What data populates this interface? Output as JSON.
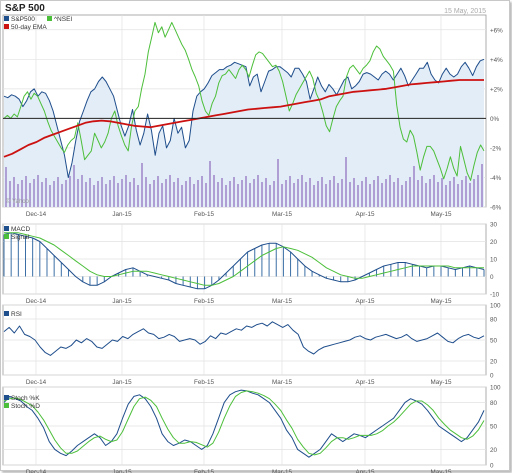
{
  "title": "S&P 500",
  "date": "15 May, 2015",
  "watermark": "© Yahoo!",
  "legend": {
    "sp500": "S&P500",
    "nsei": "^NSEI",
    "ema": "50-day EMA",
    "macd": "MACD",
    "signal": "Signal",
    "rsi": "RSI",
    "stochk": "Stoch %K",
    "stochd": "Stoch %D"
  },
  "colors": {
    "sp500": "#1f4e8c",
    "nsei": "#4cbf3a",
    "ema": "#cc1111",
    "volume": "#8a6bbd",
    "grid": "#e2e2e2",
    "fill": "#e3edf7"
  },
  "chart_data": [
    {
      "type": "line",
      "name": "price",
      "x_tick_labels": [
        "Dec-14",
        "Jan-15",
        "Feb-15",
        "Mar-15",
        "Apr-15",
        "May-15"
      ],
      "y_tick_labels": [
        "+6%",
        "+4%",
        "+2%",
        "0%",
        "-2%",
        "-4%",
        "-6%"
      ],
      "ylim": [
        -6,
        7
      ],
      "series": [
        {
          "name": "S&P500",
          "values": [
            1.5,
            1.4,
            1.6,
            1.5,
            1.3,
            0.8,
            1.2,
            1.8,
            2.0,
            1.5,
            1.8,
            1.7,
            1.2,
            0.5,
            -0.5,
            -1.5,
            -2.5,
            -4.0,
            -3.0,
            -1.5,
            -0.2,
            0.5,
            1.2,
            1.8,
            2.0,
            2.5,
            2.8,
            2.5,
            2.0,
            1.5,
            0.5,
            -0.5,
            -1.2,
            -0.5,
            0.6,
            -0.8,
            -1.8,
            -1.0,
            0.3,
            -0.8,
            -2.5,
            -1.0,
            -0.5,
            -2.0,
            -1.5,
            0.0,
            -1.0,
            -0.6,
            -2.0,
            -1.5,
            0.5,
            1.5,
            1.8,
            2.0,
            2.4,
            2.9,
            3.1,
            3.3,
            3.3,
            3.5,
            3.6,
            3.8,
            3.7,
            3.6,
            3.5,
            2.2,
            2.8,
            3.0,
            1.8,
            2.5,
            3.2,
            3.3,
            3.5,
            3.5,
            3.3,
            3.1,
            2.8,
            3.4,
            3.4,
            3.0,
            2.5,
            1.3,
            2.0,
            2.8,
            2.2,
            1.8,
            2.3,
            2.0,
            1.6,
            2.1,
            2.6,
            2.8,
            2.0,
            2.2,
            2.5,
            3.0,
            3.1,
            3.0,
            2.8,
            2.6,
            3.0,
            3.2,
            3.0,
            2.6,
            3.0,
            3.4,
            2.9,
            2.2,
            2.6,
            3.0,
            3.4,
            3.4,
            3.8,
            3.0,
            2.6,
            2.4,
            3.0,
            3.4,
            3.0,
            2.8,
            3.0,
            3.5,
            3.8,
            3.4,
            2.9,
            3.5,
            3.9,
            4.0
          ]
        },
        {
          "name": "^NSEI",
          "values": [
            0.0,
            0.2,
            0.0,
            0.3,
            0.1,
            0.8,
            1.5,
            1.8,
            1.3,
            1.7,
            1.5,
            1.0,
            0.5,
            -0.2,
            -0.8,
            -1.2,
            -1.6,
            -2.0,
            -2.3,
            -1.8,
            -1.5,
            -1.3,
            -0.3,
            -1.5,
            -2.8,
            -2.5,
            -2.2,
            -1.0,
            -1.5,
            -2.0,
            -1.6,
            -1.0,
            0.0,
            0.5,
            -0.5,
            -1.2,
            -1.8,
            -2.2,
            -0.5,
            0.5,
            0.8,
            2.0,
            3.0,
            4.5,
            5.5,
            6.5,
            5.8,
            6.2,
            5.5,
            6.0,
            6.5,
            6.0,
            5.5,
            5.0,
            4.6,
            4.0,
            3.3,
            2.8,
            2.2,
            1.2,
            0.5,
            0.2,
            1.0,
            1.5,
            2.4,
            2.9,
            3.0,
            3.3,
            3.0,
            2.7,
            3.3,
            3.6,
            3.3,
            2.8,
            3.6,
            4.3,
            4.5,
            4.4,
            4.1,
            3.8,
            3.5,
            3.6,
            3.2,
            2.5,
            1.5,
            0.5,
            1.0,
            1.6,
            2.0,
            2.4,
            2.8,
            3.2,
            2.7,
            1.7,
            1.2,
            0.4,
            -0.5,
            -0.9,
            0.0,
            0.8,
            1.2,
            1.5,
            2.8,
            3.4,
            3.6,
            3.3,
            3.0,
            3.4,
            3.6,
            3.9,
            4.5,
            4.9,
            4.7,
            4.2,
            3.9,
            3.6,
            3.2,
            0.9,
            -0.6,
            -1.4,
            -1.6,
            -0.8,
            -1.2,
            -2.3,
            -3.5,
            -2.6,
            -1.9,
            -1.9,
            -2.2,
            -2.8,
            -3.4,
            -4.1,
            -3.4,
            -2.6,
            -3.4,
            -3.9,
            -1.9,
            -2.8,
            -3.7,
            -4.2,
            -3.2,
            -2.3,
            -1.8,
            -2.2
          ]
        },
        {
          "name": "50-day EMA",
          "values": [
            -2.6,
            -2.4,
            -2.1,
            -1.8,
            -1.6,
            -1.3,
            -1.1,
            -0.9,
            -0.7,
            -0.5,
            -0.3,
            -0.2,
            -0.15,
            -0.2,
            -0.3,
            -0.4,
            -0.5,
            -0.55,
            -0.6,
            -0.5,
            -0.4,
            -0.3,
            -0.2,
            -0.1,
            0.0,
            0.1,
            0.2,
            0.3,
            0.4,
            0.5,
            0.6,
            0.65,
            0.7,
            0.75,
            0.8,
            0.9,
            1.0,
            1.1,
            1.2,
            1.3,
            1.5,
            1.6,
            1.7,
            1.8,
            1.85,
            1.9,
            1.95,
            2.0,
            2.1,
            2.2,
            2.3,
            2.35,
            2.4,
            2.45,
            2.5,
            2.55,
            2.6,
            2.6,
            2.6,
            2.6
          ]
        }
      ]
    },
    {
      "type": "line",
      "name": "macd",
      "y_tick_labels": [
        "30",
        "20",
        "10",
        "0",
        "-10"
      ],
      "ylim": [
        -10,
        30
      ],
      "series": [
        {
          "name": "MACD",
          "values": [
            24,
            25,
            24,
            23,
            22,
            20,
            16,
            12,
            8,
            4,
            0,
            -3,
            -5,
            -5,
            -3,
            0,
            2,
            4,
            5,
            3,
            1,
            0,
            -1,
            -2,
            -4,
            -5,
            -6,
            -7,
            -7,
            -5,
            -2,
            2,
            6,
            10,
            14,
            16,
            18,
            19,
            19,
            17,
            14,
            10,
            6,
            3,
            1,
            -1,
            -2,
            -3,
            -3,
            -2,
            0,
            2,
            4,
            6,
            7,
            8,
            8,
            7,
            6,
            5,
            6,
            6,
            5,
            4,
            5,
            6,
            5,
            4
          ]
        },
        {
          "name": "Signal",
          "values": [
            25,
            25,
            25,
            24,
            23,
            22,
            20,
            18,
            15,
            12,
            9,
            6,
            3,
            1,
            0,
            0,
            1,
            2,
            3,
            3,
            3,
            2,
            1,
            0,
            -1,
            -2,
            -3,
            -4,
            -5,
            -5,
            -4,
            -2,
            0,
            3,
            6,
            9,
            12,
            14,
            16,
            17,
            16,
            15,
            13,
            11,
            8,
            5,
            3,
            1,
            0,
            -1,
            -1,
            0,
            1,
            2,
            3,
            4,
            5,
            6,
            6,
            6,
            6,
            6,
            6,
            5,
            5,
            5,
            5,
            5
          ]
        }
      ]
    },
    {
      "type": "line",
      "name": "rsi",
      "y_tick_labels": [
        "100",
        "80",
        "50",
        "20",
        "0"
      ],
      "ylim": [
        0,
        100
      ],
      "series": [
        {
          "name": "RSI",
          "values": [
            62,
            68,
            60,
            70,
            58,
            55,
            50,
            40,
            32,
            28,
            34,
            40,
            38,
            42,
            50,
            46,
            52,
            48,
            40,
            38,
            44,
            50,
            48,
            55,
            52,
            58,
            62,
            66,
            60,
            58,
            52,
            54,
            58,
            55,
            48,
            50,
            52,
            50,
            44,
            48,
            56,
            52,
            60,
            58,
            62,
            66,
            64,
            70,
            68,
            72,
            74,
            70,
            76,
            72,
            68,
            72,
            64,
            58,
            40,
            34,
            30,
            36,
            40,
            42,
            44,
            46,
            48,
            50,
            54,
            56,
            52,
            50,
            54,
            56,
            58,
            55,
            52,
            54,
            58,
            52,
            48,
            50,
            52,
            56,
            60,
            54,
            48,
            46,
            52,
            56,
            58,
            54,
            52,
            56
          ]
        }
      ]
    },
    {
      "type": "line",
      "name": "stochastic",
      "y_tick_labels": [
        "100",
        "80",
        "50",
        "20",
        "0"
      ],
      "ylim": [
        0,
        100
      ],
      "series": [
        {
          "name": "Stoch %K",
          "values": [
            80,
            88,
            85,
            82,
            75,
            70,
            60,
            48,
            30,
            20,
            15,
            12,
            18,
            25,
            30,
            35,
            40,
            35,
            25,
            30,
            40,
            60,
            78,
            88,
            90,
            85,
            75,
            60,
            40,
            30,
            25,
            28,
            32,
            30,
            25,
            20,
            25,
            40,
            60,
            80,
            90,
            94,
            96,
            95,
            92,
            90,
            85,
            80,
            70,
            60,
            45,
            35,
            20,
            15,
            10,
            15,
            20,
            30,
            40,
            35,
            30,
            35,
            40,
            38,
            35,
            40,
            45,
            50,
            55,
            60,
            70,
            80,
            85,
            82,
            78,
            70,
            60,
            50,
            45,
            40,
            35,
            30,
            35,
            45,
            55,
            70
          ]
        },
        {
          "name": "Stoch %D",
          "values": [
            82,
            85,
            86,
            84,
            80,
            76,
            68,
            58,
            45,
            32,
            22,
            15,
            15,
            18,
            24,
            30,
            35,
            37,
            33,
            30,
            32,
            43,
            59,
            75,
            85,
            87,
            83,
            75,
            60,
            46,
            35,
            28,
            28,
            30,
            29,
            26,
            23,
            28,
            42,
            60,
            76,
            88,
            93,
            95,
            94,
            92,
            89,
            85,
            78,
            70,
            58,
            47,
            33,
            23,
            15,
            13,
            15,
            22,
            30,
            35,
            35,
            33,
            35,
            38,
            38,
            38,
            40,
            44,
            50,
            55,
            62,
            70,
            78,
            82,
            82,
            77,
            70,
            60,
            52,
            45,
            40,
            35,
            33,
            37,
            45,
            57
          ]
        }
      ]
    }
  ]
}
